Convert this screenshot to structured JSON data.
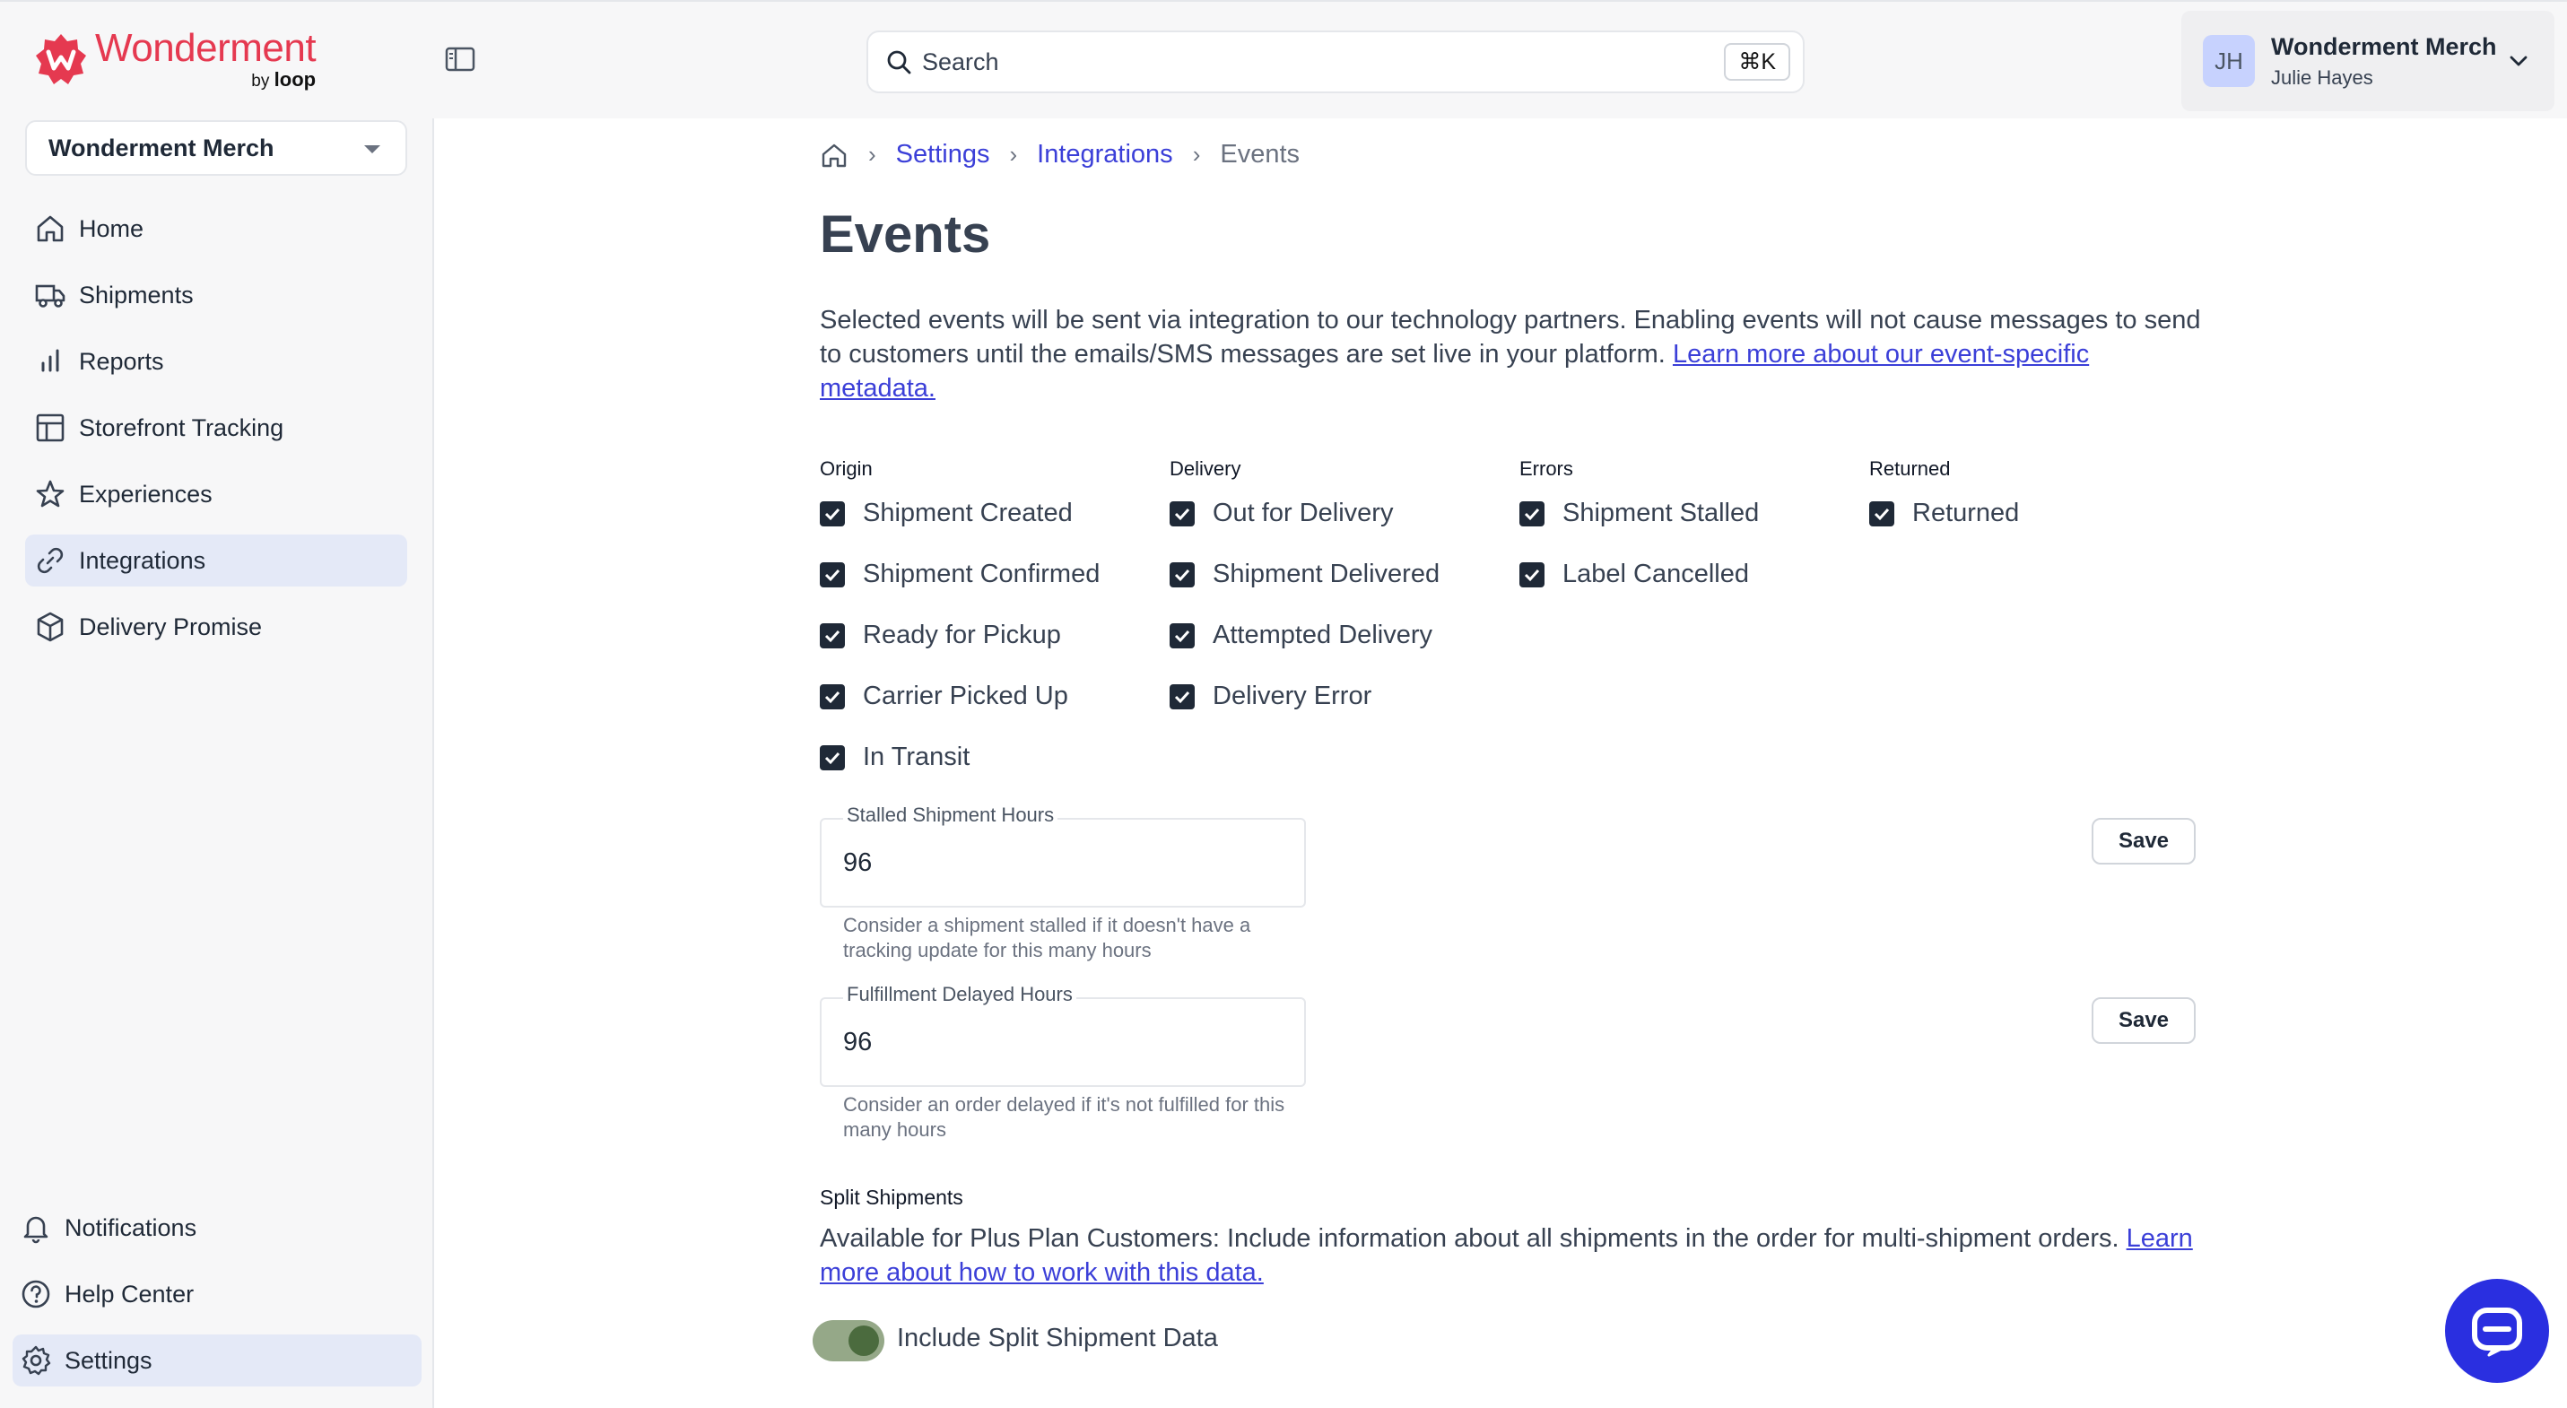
{
  "brand": {
    "name": "Wonderment",
    "by": "by",
    "by_brand": "loop",
    "color": "#e53950"
  },
  "search": {
    "placeholder": "Search",
    "shortcut": "⌘K"
  },
  "account": {
    "initials": "JH",
    "store": "Wonderment Merch",
    "user": "Julie Hayes"
  },
  "sidebar": {
    "store_selector": "Wonderment Merch",
    "items": [
      {
        "label": "Home",
        "icon": "home-icon"
      },
      {
        "label": "Shipments",
        "icon": "truck-icon"
      },
      {
        "label": "Reports",
        "icon": "bar-chart-icon"
      },
      {
        "label": "Storefront Tracking",
        "icon": "layout-icon"
      },
      {
        "label": "Experiences",
        "icon": "star-icon"
      },
      {
        "label": "Integrations",
        "icon": "link-icon",
        "active": true
      },
      {
        "label": "Delivery Promise",
        "icon": "box-icon"
      }
    ],
    "bottom": [
      {
        "label": "Notifications",
        "icon": "bell-icon"
      },
      {
        "label": "Help Center",
        "icon": "help-icon"
      },
      {
        "label": "Settings",
        "icon": "gear-icon",
        "active": true
      }
    ]
  },
  "breadcrumb": {
    "settings": "Settings",
    "integrations": "Integrations",
    "current": "Events"
  },
  "page": {
    "title": "Events",
    "description": "Selected events will be sent via integration to our technology partners. Enabling events will not cause messages to send to customers until the emails/SMS messages are set live in your platform. ",
    "description_link": "Learn more about our event-specific metadata."
  },
  "events": {
    "origin": {
      "heading": "Origin",
      "items": [
        "Shipment Created",
        "Shipment Confirmed",
        "Ready for Pickup",
        "Carrier Picked Up",
        "In Transit"
      ]
    },
    "delivery": {
      "heading": "Delivery",
      "items": [
        "Out for Delivery",
        "Shipment Delivered",
        "Attempted Delivery",
        "Delivery Error"
      ]
    },
    "errors": {
      "heading": "Errors",
      "items": [
        "Shipment Stalled",
        "Label Cancelled"
      ]
    },
    "returned": {
      "heading": "Returned",
      "items": [
        "Returned"
      ]
    }
  },
  "stalled": {
    "label": "Stalled Shipment Hours",
    "value": "96",
    "help": "Consider a shipment stalled if it doesn't have a tracking update for this many hours",
    "save": "Save"
  },
  "fulfillment": {
    "label": "Fulfillment Delayed Hours",
    "value": "96",
    "help": "Consider an order delayed if it's not fulfilled for this many hours",
    "save": "Save"
  },
  "split": {
    "heading": "Split Shipments",
    "description": "Available for Plus Plan Customers: Include information about all shipments in the order for multi-shipment orders. ",
    "link": "Learn more about how to work with this data.",
    "toggle_label": "Include Split Shipment Data",
    "toggle_on": true
  },
  "colors": {
    "accent": "#3b3fd8",
    "chat": "#2a2fe0",
    "active_nav": "#e4e9f7"
  }
}
